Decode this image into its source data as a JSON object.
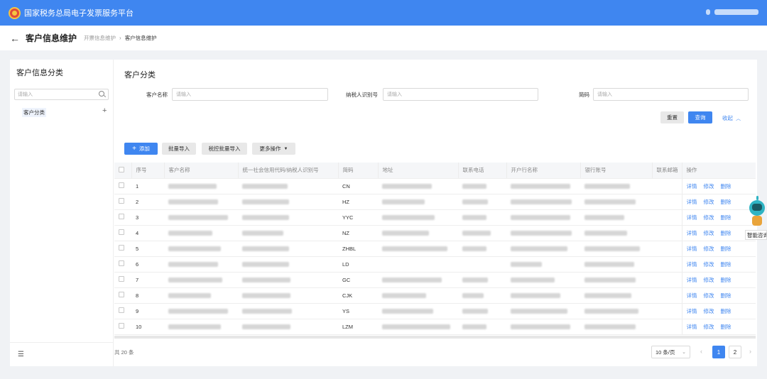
{
  "app": {
    "title": "国家税务总局电子发票服务平台"
  },
  "header": {
    "title": "客户信息维护",
    "breadcrumb": [
      "开票信息维护",
      "客户信息维护"
    ]
  },
  "sidebar": {
    "title": "客户信息分类",
    "search_placeholder": "请输入",
    "items": [
      {
        "label": "客户分类"
      }
    ],
    "add_icon": "plus-icon",
    "menu_icon": "menu-icon"
  },
  "main": {
    "title": "客户分类",
    "filters": {
      "customer_name_label": "客户名称",
      "customer_name_placeholder": "请输入",
      "taxpayer_id_label": "纳税人识别号",
      "taxpayer_id_placeholder": "请输入",
      "short_code_label": "简码",
      "short_code_placeholder": "请输入"
    },
    "reset_label": "重置",
    "query_label": "查询",
    "collapse_label": "收起",
    "toolbar": {
      "add_label": "添加",
      "batch_import_label": "批量导入",
      "tax_control_import_label": "税控批量导入",
      "more_label": "更多操作"
    },
    "table": {
      "columns": [
        "序号",
        "客户名称",
        "统一社会信用代码/纳税人识别号",
        "简码",
        "地址",
        "联系电话",
        "开户行名称",
        "银行账号",
        "联系邮箱",
        "操作"
      ],
      "actions": [
        "详情",
        "修改",
        "删除"
      ],
      "rows": [
        {
          "no": "1",
          "code": "CN"
        },
        {
          "no": "2",
          "code": "HZ"
        },
        {
          "no": "3",
          "code": "YYC"
        },
        {
          "no": "4",
          "code": "NZ"
        },
        {
          "no": "5",
          "code": "ZHBL"
        },
        {
          "no": "6",
          "code": "LD"
        },
        {
          "no": "7",
          "code": "GC"
        },
        {
          "no": "8",
          "code": "CJK"
        },
        {
          "no": "9",
          "code": "YS"
        },
        {
          "no": "10",
          "code": "LZM"
        }
      ]
    },
    "pagination": {
      "total": "共 20 条",
      "page_size": "10 条/页",
      "pages": [
        "1",
        "2"
      ],
      "current": "1"
    }
  },
  "assistant": {
    "label": "智能咨询"
  },
  "colors": {
    "primary": "#3f86f0",
    "background": "#f0f2f5"
  }
}
